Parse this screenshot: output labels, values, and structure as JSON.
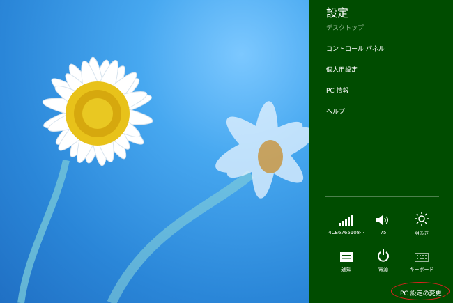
{
  "charm": {
    "title": "設定",
    "menu": [
      "デスクトップ",
      "コントロール パネル",
      "個人用設定",
      "PC 情報",
      "ヘルプ"
    ],
    "quick_settings": {
      "network": "4CE6765108···",
      "volume": "75",
      "brightness": "明るさ",
      "notifications": "通知",
      "power": "電源",
      "keyboard": "キーボード"
    },
    "change_pc_settings": "PC 設定の変更"
  },
  "colors": {
    "charm_background": "#004c00",
    "highlight": "#e02020"
  },
  "icons": [
    "network-signal-icon",
    "speaker-icon",
    "brightness-icon",
    "notification-icon",
    "power-icon",
    "keyboard-icon"
  ]
}
